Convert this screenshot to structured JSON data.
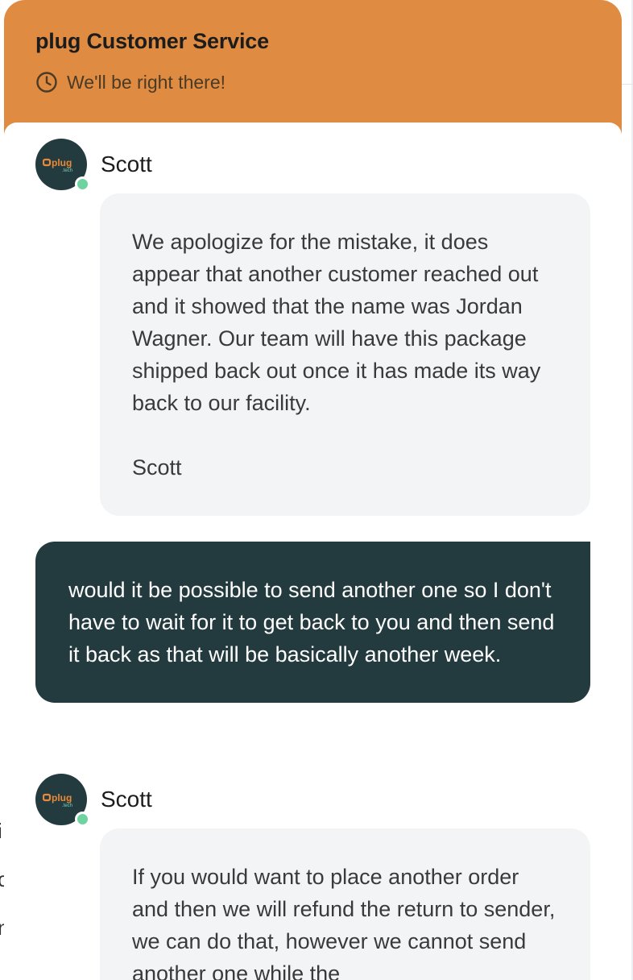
{
  "header": {
    "title": "plug Customer Service",
    "status": "We'll be right there!",
    "status_icon": "clock-icon"
  },
  "colors": {
    "header_bg": "#df8c42",
    "user_bubble": "#233b3f",
    "agent_bubble": "#f3f4f6",
    "online": "#6fd3a0"
  },
  "avatar": {
    "logo_text": "plug",
    "logo_subtext": ".tech"
  },
  "messages": [
    {
      "sender": "agent",
      "name": "Scott",
      "text": "We apologize for the mistake, it does appear that another customer reached out and it showed that the name was Jordan Wagner. Our team will have this package shipped back out once it has made its way back to our facility.\n\nScott"
    },
    {
      "sender": "user",
      "text": "would it be possible to send another one so I don't have to wait for it to get back to you and then send it back as that will be basically another week."
    },
    {
      "sender": "agent",
      "name": "Scott",
      "text": "If you would want to place another order and then we will refund the return to sender, we can do that, however we cannot send another one while the"
    }
  ],
  "background_fragments": [
    "i",
    "c",
    "n"
  ]
}
